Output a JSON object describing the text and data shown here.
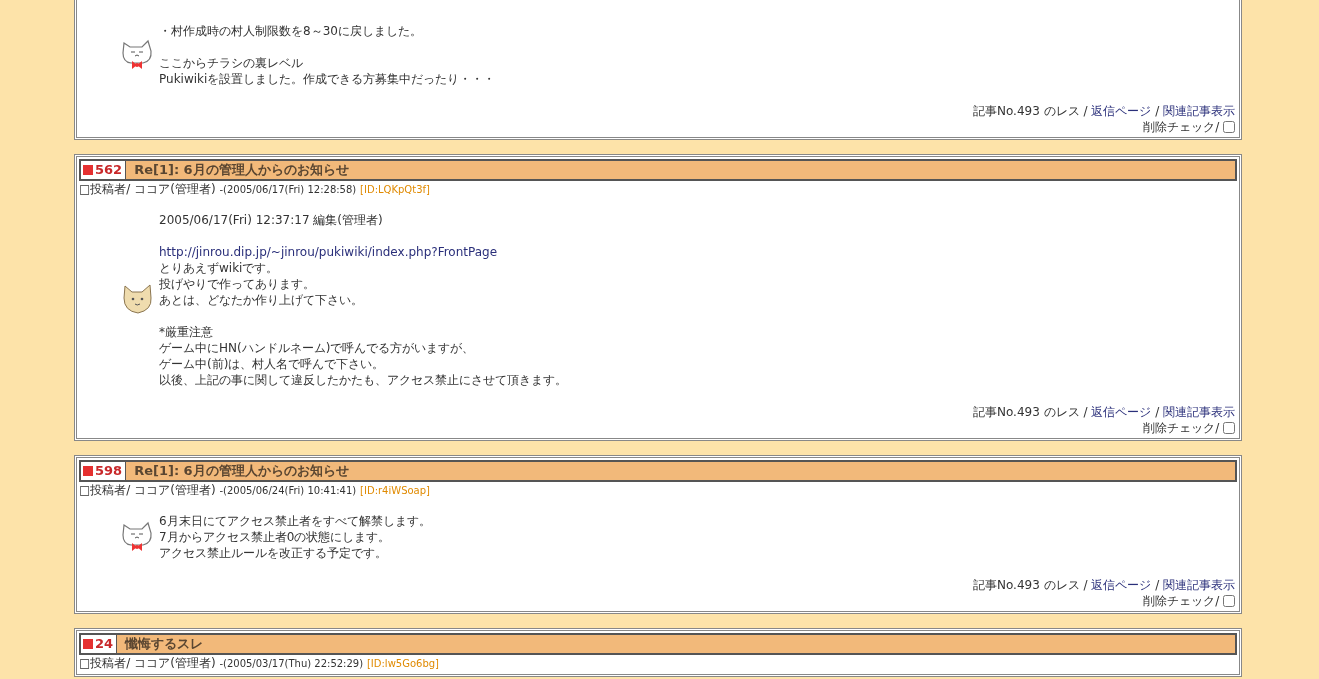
{
  "posts": [
    {
      "avatar": {
        "kind": "white-cat"
      },
      "paragraphs": [
        [
          {
            "kind": "text",
            "text": "・村作成時の村人制限数を8～30に戻しました。"
          }
        ],
        [
          {
            "kind": "text",
            "text": "ここからチラシの裏レベル"
          },
          {
            "kind": "text",
            "text": "Pukiwikiを設置しました。作成できる方募集中だったり・・・"
          }
        ]
      ],
      "footer": [
        {
          "kind": "text",
          "text": "記事No.493 のレス"
        },
        {
          "kind": "text",
          "text": "/"
        },
        {
          "kind": "link",
          "text": "返信ページ"
        },
        {
          "kind": "text",
          "text": "/"
        },
        {
          "kind": "link",
          "text": "関連記事表示"
        }
      ],
      "delete_label": "削除チェック/",
      "delete_checked": false
    },
    {
      "number": "562",
      "title": "Re[1]: 6月の管理人からのお知らせ",
      "author": "□投稿者/ ココア(管理者)",
      "date": "-(2005/06/17(Fri) 12:28:58)",
      "id": "[ID:LQKpQt3f]",
      "avatar": {
        "kind": "beige-cat"
      },
      "paragraphs": [
        [
          {
            "kind": "text",
            "text": "2005/06/17(Fri) 12:37:17 編集(管理者)"
          }
        ],
        [
          {
            "kind": "link",
            "text": "http://jinrou.dip.jp/~jinrou/pukiwiki/index.php?FrontPage"
          },
          {
            "kind": "text",
            "text": "とりあえずwikiです。"
          },
          {
            "kind": "text",
            "text": "投げやりで作ってあります。"
          },
          {
            "kind": "text",
            "text": "あとは、どなたか作り上げて下さい。"
          }
        ],
        [
          {
            "kind": "text",
            "text": "*厳重注意"
          },
          {
            "kind": "text",
            "text": "ゲーム中にHN(ハンドルネーム)で呼んでる方がいますが、"
          },
          {
            "kind": "text",
            "text": "ゲーム中(前)は、村人名で呼んで下さい。"
          },
          {
            "kind": "text",
            "text": "以後、上記の事に関して違反したかたも、アクセス禁止にさせて頂きます。"
          }
        ]
      ],
      "footer": [
        {
          "kind": "text",
          "text": "記事No.493 のレス"
        },
        {
          "kind": "text",
          "text": "/"
        },
        {
          "kind": "link",
          "text": "返信ページ"
        },
        {
          "kind": "text",
          "text": "/"
        },
        {
          "kind": "link",
          "text": "関連記事表示"
        }
      ],
      "delete_label": "削除チェック/",
      "delete_checked": false
    },
    {
      "number": "598",
      "title": "Re[1]: 6月の管理人からのお知らせ",
      "author": "□投稿者/ ココア(管理者)",
      "date": "-(2005/06/24(Fri) 10:41:41)",
      "id": "[ID:r4iWSoap]",
      "avatar": {
        "kind": "white-cat"
      },
      "paragraphs": [
        [
          {
            "kind": "text",
            "text": "6月末日にてアクセス禁止者をすべて解禁します。"
          },
          {
            "kind": "text",
            "text": "7月からアクセス禁止者0の状態にします。"
          },
          {
            "kind": "text",
            "text": "アクセス禁止ルールを改正する予定です。"
          }
        ]
      ],
      "footer": [
        {
          "kind": "text",
          "text": "記事No.493 のレス"
        },
        {
          "kind": "text",
          "text": "/"
        },
        {
          "kind": "link",
          "text": "返信ページ"
        },
        {
          "kind": "text",
          "text": "/"
        },
        {
          "kind": "link",
          "text": "関連記事表示"
        }
      ],
      "delete_label": "削除チェック/",
      "delete_checked": false
    },
    {
      "number": "24",
      "title": "懺悔するスレ",
      "author": "□投稿者/ ココア(管理者)",
      "date": "-(2005/03/17(Thu) 22:52:29)",
      "id": "[ID:lw5Go6bg]"
    }
  ]
}
